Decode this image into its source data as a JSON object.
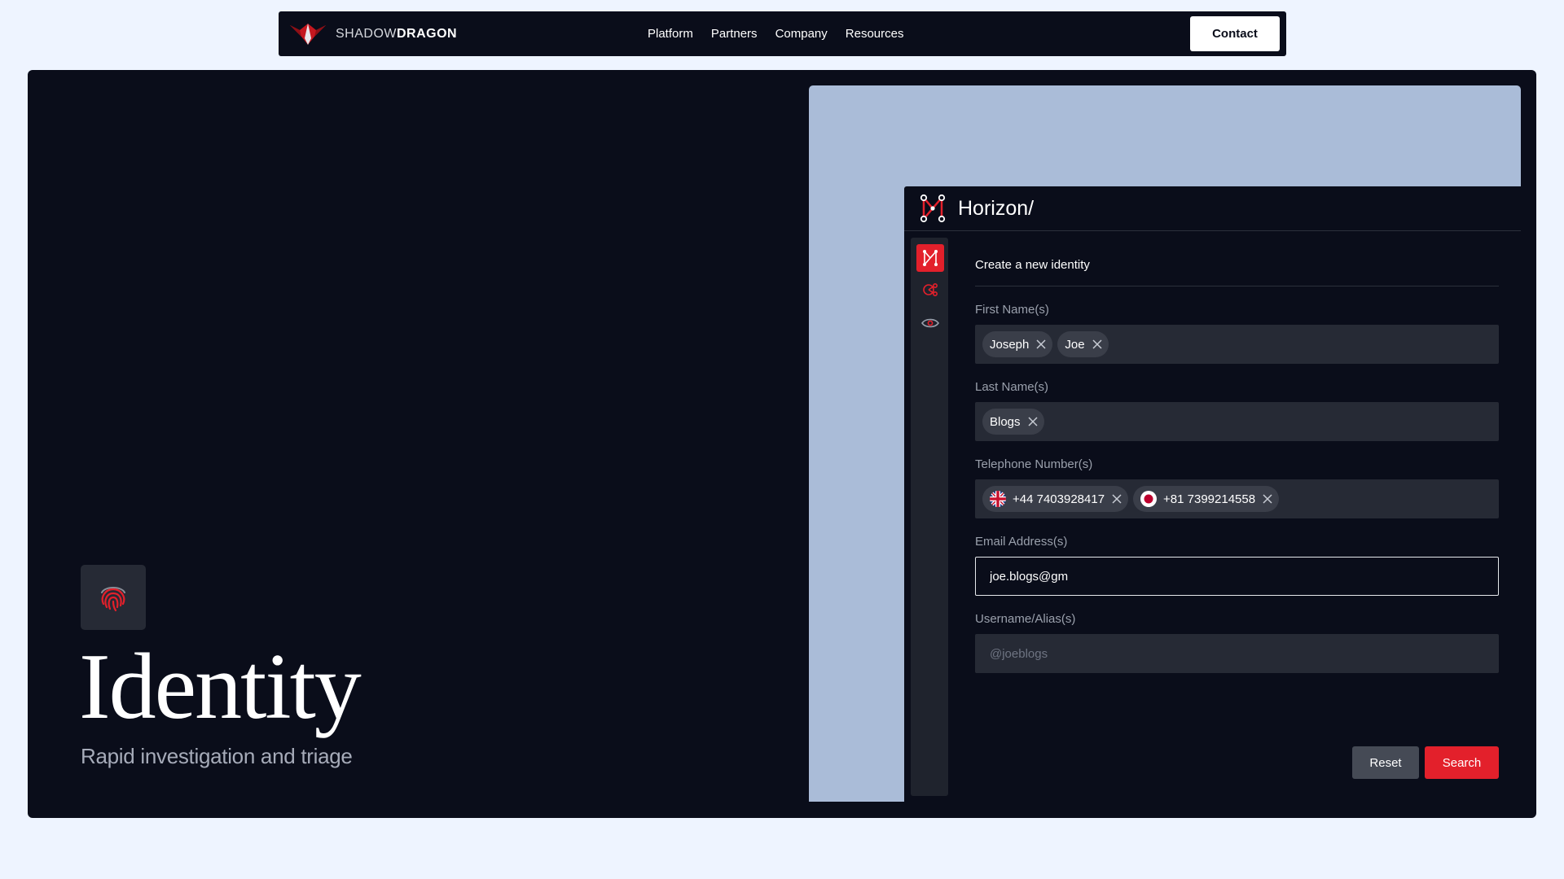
{
  "nav": {
    "brand_thin": "SHADOW",
    "brand_bold": "DRAGON",
    "links": [
      "Platform",
      "Partners",
      "Company",
      "Resources"
    ],
    "contact_label": "Contact"
  },
  "hero": {
    "title": "Identity",
    "subtitle": "Rapid investigation and triage"
  },
  "app": {
    "title": "Horizon/",
    "form_heading": "Create a new identity",
    "fields": {
      "first_names": {
        "label": "First Name(s)",
        "chips": [
          "Joseph",
          "Joe"
        ]
      },
      "last_names": {
        "label": "Last Name(s)",
        "chips": [
          "Blogs"
        ]
      },
      "phones": {
        "label": "Telephone Number(s)",
        "chips": [
          {
            "flag": "uk-flag-icon",
            "number": "+44 7403928417"
          },
          {
            "flag": "japan-flag-icon",
            "number": "+81 7399214558"
          }
        ]
      },
      "email": {
        "label": "Email Address(s)",
        "value": "joe.blogs@gm"
      },
      "username": {
        "label": "Username/Alias(s)",
        "placeholder": "@joeblogs"
      }
    },
    "buttons": {
      "reset": "Reset",
      "search": "Search"
    }
  },
  "colors": {
    "accent": "#e3202b",
    "dark_bg": "#0a0d1a",
    "mockup_bg": "#aabcd8",
    "page_bg": "#eef4ff"
  }
}
